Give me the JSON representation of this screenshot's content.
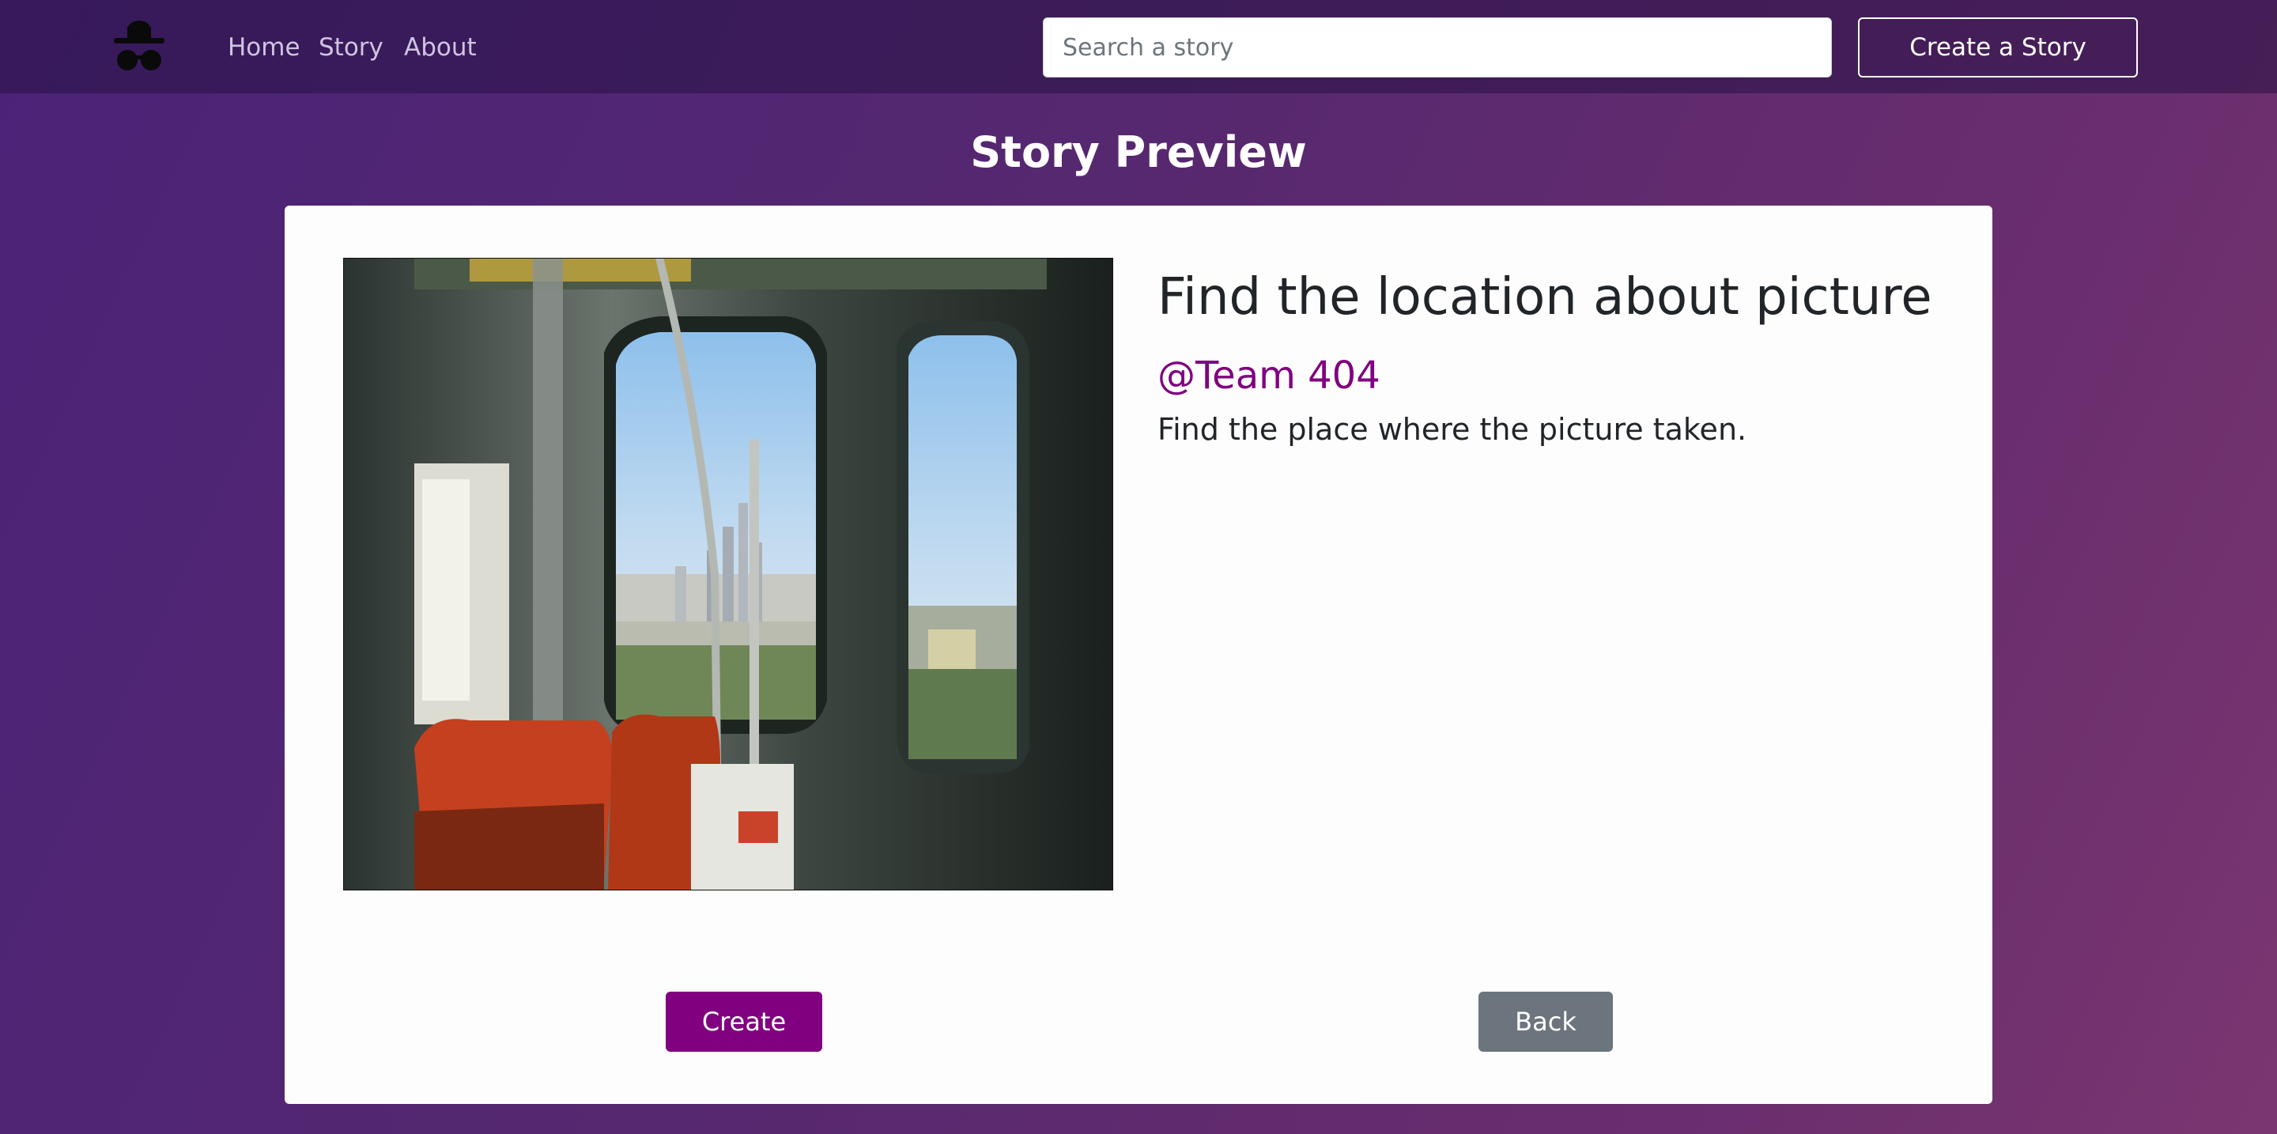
{
  "nav": {
    "links": [
      "Home",
      "Story",
      "About"
    ],
    "search_placeholder": "Search a story",
    "create_story_label": "Create a Story"
  },
  "page": {
    "title": "Story Preview"
  },
  "story": {
    "title": "Find the location about picture",
    "author": "@Team 404",
    "description": "Find the place where the picture taken.",
    "image_icon": "train-interior-photo"
  },
  "actions": {
    "create_label": "Create",
    "back_label": "Back"
  },
  "colors": {
    "accent": "#800080",
    "secondary": "#6c757d",
    "background_start": "#4a2378",
    "background_end": "#7a3670"
  }
}
